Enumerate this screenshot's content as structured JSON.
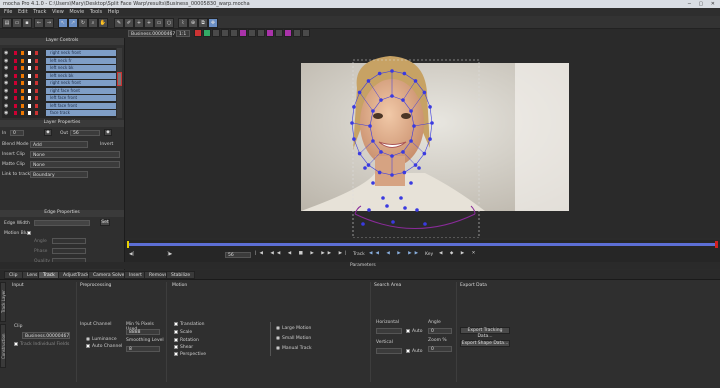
{
  "window": {
    "title": "mocha Pro 4.1.0 - C:\\Users\\Mary\\Desktop\\Split Face Warp\\results\\Business_00005830_warp.mocha"
  },
  "menu": [
    "File",
    "Edit",
    "Track",
    "View",
    "Movie",
    "Tools",
    "Help"
  ],
  "clip_selector": {
    "value": "Business.00000467",
    "zoom": "1:1"
  },
  "layer_controls": {
    "header": "Layer Controls",
    "layers": [
      "right neck front",
      "left neck fr",
      "left neck bk",
      "left neck bk",
      "right neck front",
      "right face front",
      "left face front",
      "left face front",
      "face track"
    ]
  },
  "layer_properties": {
    "header": "Layer Properties",
    "in_label": "In",
    "in_value": "0",
    "out_label": "Out",
    "out_value": "56",
    "blend_mode_label": "Blend Mode",
    "blend_mode_value": "Add",
    "invert_label": "Invert",
    "insert_clip_label": "Insert Clip",
    "insert_clip_value": "None",
    "matte_clip_label": "Matte Clip",
    "matte_clip_value": "None",
    "link_label": "Link to track",
    "link_value": "Boundary"
  },
  "edge_properties": {
    "header": "Edge Properties",
    "edge_width_label": "Edge Width",
    "edge_width_value": "",
    "set_label": "Set",
    "motion_blur_label": "Motion Blur",
    "angle_label": "Angle",
    "phase_label": "Phase",
    "quality_label": "Quality"
  },
  "timeline": {
    "frame": "56",
    "track_label": "Track",
    "key_label": "Key",
    "params_label": "Parameters"
  },
  "tabs": [
    "Clip",
    "Lens",
    "Track",
    "AdjustTrack",
    "Camera Solve",
    "Insert",
    "Remove",
    "Stabilize"
  ],
  "active_tab": "Track",
  "vertical_tabs": [
    "Track Layer",
    "Construction"
  ],
  "params": {
    "input_header": "Input",
    "preprocessing_header": "Preprocessing",
    "motion_header": "Motion",
    "search_area_header": "Search Area",
    "export_header": "Export Data",
    "clip_label": "Clip",
    "clip_value": "Business.00000467",
    "track_individual_label": "Track Individual Fields",
    "input_channel_label": "Input Channel",
    "luminance_label": "Luminance",
    "auto_channel_label": "Auto Channel",
    "min_pixels_label": "Min % Pixels Used",
    "min_pixels_value": "8888",
    "smoothing_label": "Smoothing Level",
    "smoothing_value": "8",
    "motions": [
      "Translation",
      "Scale",
      "Rotation",
      "Shear",
      "Perspective"
    ],
    "motion_options": [
      "Large Motion",
      "Small Motion",
      "Manual Track"
    ],
    "horizontal_label": "Horizontal",
    "vertical_label": "Vertical",
    "auto_label": "Auto",
    "angle_label": "Angle",
    "zoom_label": "Zoom %",
    "angle_value": "0",
    "zoom_value": "0",
    "export_tracking_label": "Export Tracking Data...",
    "export_shape_label": "Export Shape Data..."
  },
  "colors": {
    "layer_selected": "#7f9ec6",
    "track_point": "#3a3ae0",
    "spline": "#8a2a9a",
    "playhead": "#d02020"
  }
}
